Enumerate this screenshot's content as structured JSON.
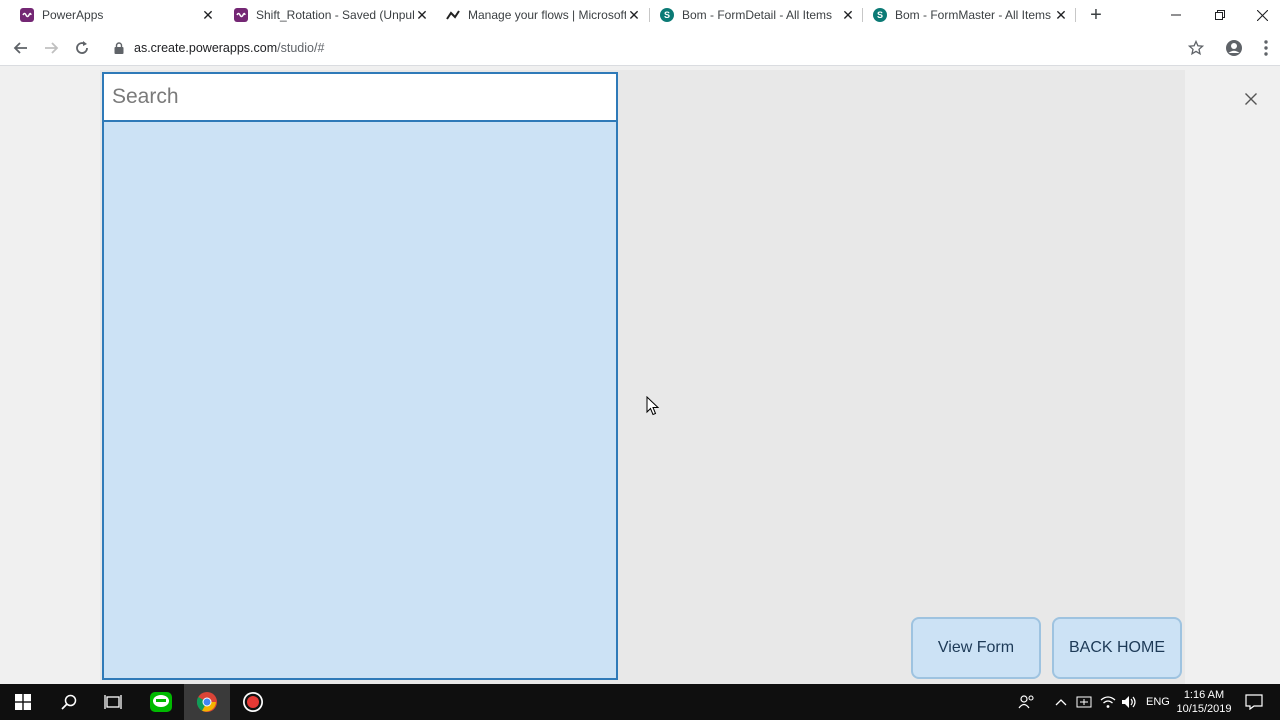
{
  "browser": {
    "tabs": [
      {
        "title": "PowerApps",
        "favicon": "powerapps-icon",
        "active": false
      },
      {
        "title": "Shift_Rotation - Saved (Unpubl",
        "favicon": "powerapps-icon",
        "active": true
      },
      {
        "title": "Manage your flows | Microsoft",
        "favicon": "flow-icon",
        "active": false
      },
      {
        "title": "Bom - FormDetail - All Items",
        "favicon": "sharepoint-icon",
        "active": false
      },
      {
        "title": "Bom - FormMaster - All Items",
        "favicon": "sharepoint-icon",
        "active": false
      }
    ],
    "new_tab_label": "+",
    "url_host": "as.create.powerapps.com",
    "url_path": "/studio/#"
  },
  "app": {
    "search_placeholder": "Search",
    "search_value": "",
    "view_form_label": "View Form",
    "back_home_label": "BACK HOME"
  },
  "taskbar": {
    "language": "ENG",
    "time": "1:16 AM",
    "date": "10/15/2019"
  },
  "colors": {
    "gallery_fill": "#cce2f5",
    "border_accent": "#2f7ab8",
    "canvas_bg": "#e8e8e8",
    "powerapps_brand": "#742774",
    "sharepoint_brand": "#0b7a75"
  }
}
